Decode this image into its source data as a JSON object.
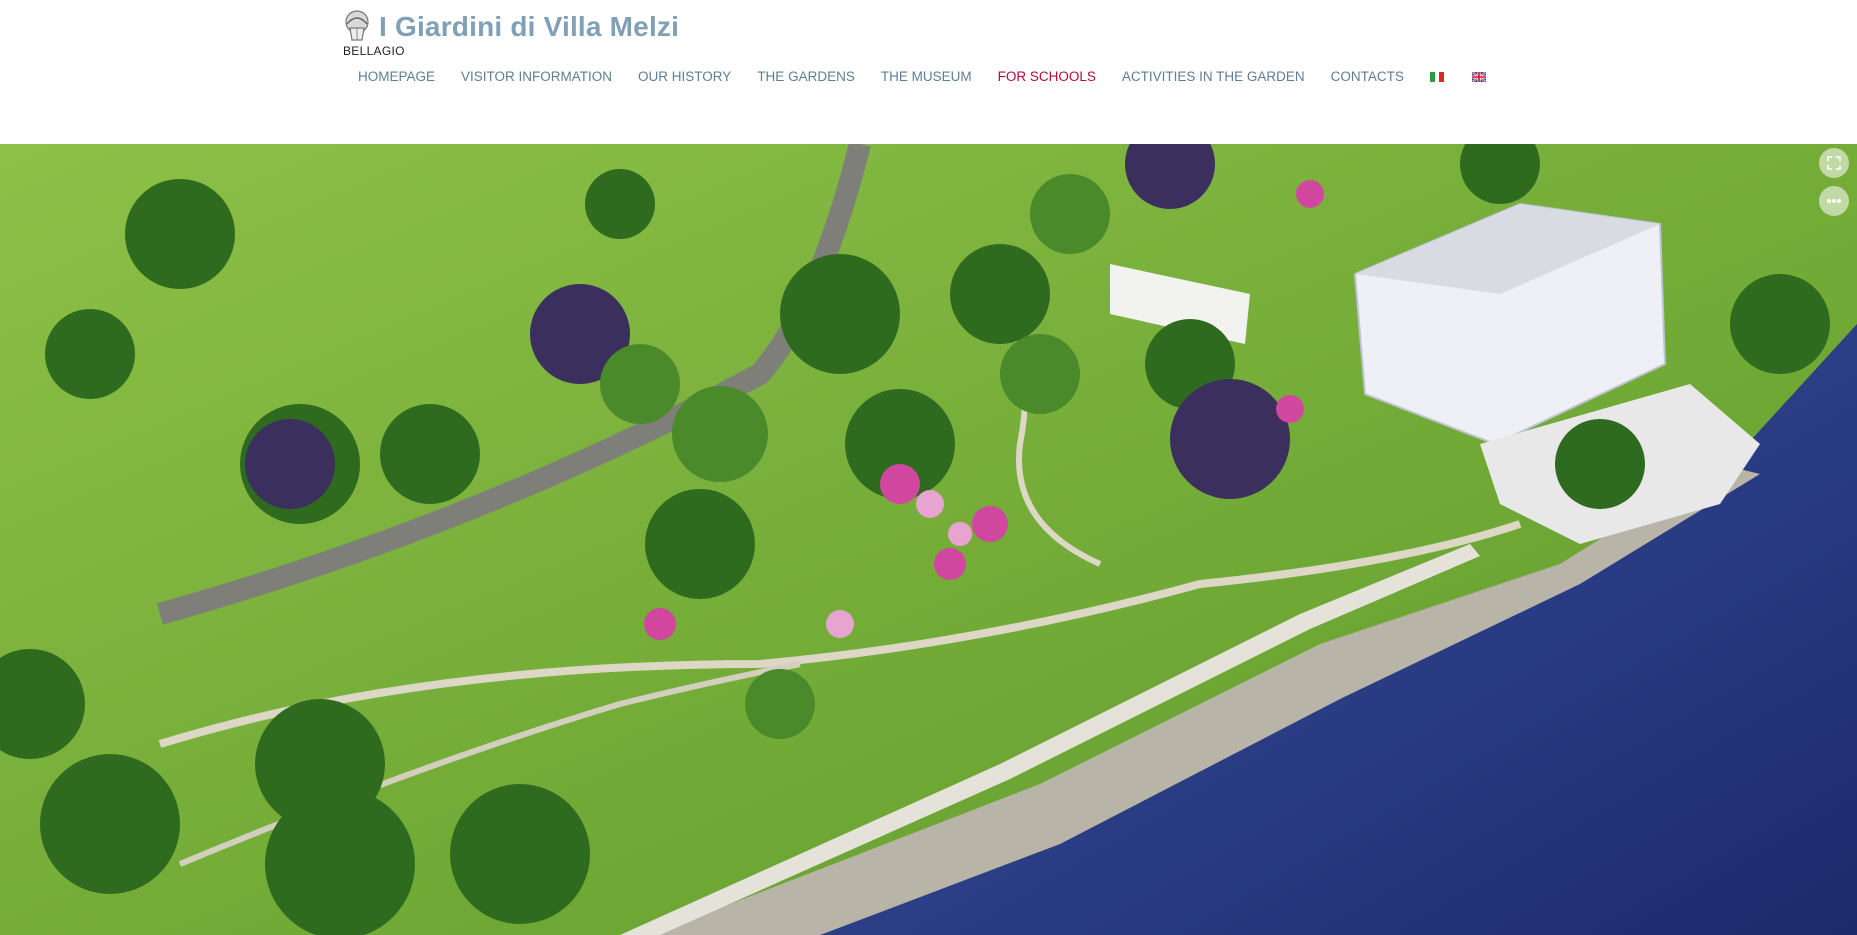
{
  "site": {
    "title": "I Giardini di Villa Melzi",
    "subtitle": "BELLAGIO"
  },
  "nav": {
    "items": [
      {
        "label": "HOMEPAGE"
      },
      {
        "label": "VISITOR INFORMATION"
      },
      {
        "label": "OUR HISTORY"
      },
      {
        "label": "THE GARDENS"
      },
      {
        "label": "THE MUSEUM"
      },
      {
        "label": "FOR SCHOOLS"
      },
      {
        "label": "ACTIVITIES IN THE GARDEN"
      },
      {
        "label": "CONTACTS"
      }
    ],
    "active_label": "FOR SCHOOLS",
    "languages": [
      "italian-flag-icon",
      "english-flag-icon"
    ]
  },
  "hero": {
    "controls": [
      "fullscreen-icon",
      "more-icon"
    ]
  },
  "colors": {
    "title": "#7fa0b5",
    "nav": "#5d7e95",
    "nav_active": "#b10c3f",
    "lawn": "#7db33a",
    "lake": "#22337e"
  }
}
